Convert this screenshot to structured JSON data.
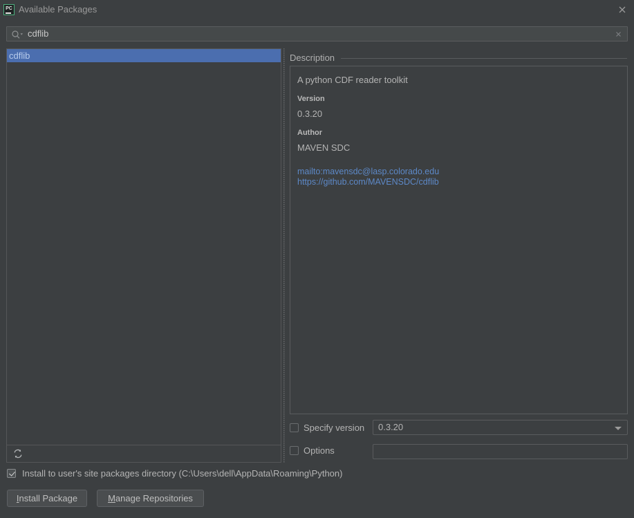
{
  "window": {
    "title": "Available Packages",
    "app_icon": "pycharm-icon",
    "close_icon": "close-icon",
    "accent_selection": "#4b6eaf",
    "link_color": "#5d89c8",
    "background": "#3c3f41"
  },
  "search": {
    "value": "cdflib",
    "placeholder": "",
    "search_icon": "search-icon",
    "clear_icon": "clear-icon"
  },
  "package_list": {
    "items": [
      {
        "label": "cdflib",
        "selected": true
      }
    ],
    "toolbar": {
      "refresh_icon": "refresh-icon"
    }
  },
  "description": {
    "group_title": "Description",
    "summary": "A python CDF reader toolkit",
    "version_label": "Version",
    "version_value": "0.3.20",
    "author_label": "Author",
    "author_value": "MAVEN SDC",
    "links": [
      "mailto:mavensdc@lasp.colorado.edu",
      "https://github.com/MAVENSDC/cdflib"
    ]
  },
  "options": {
    "specify_version_label": "Specify version",
    "specify_version_checked": false,
    "version_selected": "0.3.20",
    "version_dropdown_icon": "chevron-down-icon",
    "options_label": "Options",
    "options_checked": false,
    "options_value": "",
    "options_placeholder": ""
  },
  "footer": {
    "install_user_label": "Install to user's site packages directory (C:\\Users\\dell\\AppData\\Roaming\\Python)",
    "install_user_checked": true,
    "install_button": {
      "mnemonic": "I",
      "rest": "nstall Package"
    },
    "manage_button": {
      "mnemonic": "M",
      "rest": "anage Repositories"
    }
  }
}
